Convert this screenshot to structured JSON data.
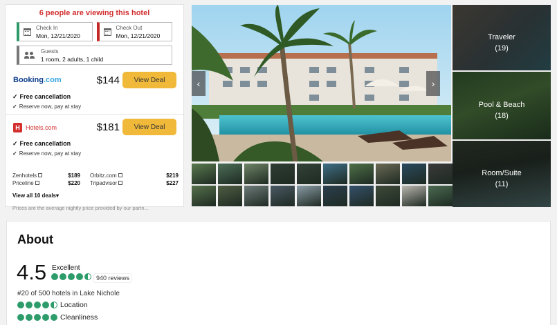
{
  "deal": {
    "viewing_notice": "6 people are viewing this hotel",
    "check_in": {
      "label": "Check In",
      "value": "Mon, 12/21/2020"
    },
    "check_out": {
      "label": "Check Out",
      "value": "Mon, 12/21/2020"
    },
    "guests": {
      "label": "Guests",
      "value": "1 room, 2 adults, 1 child"
    },
    "providers": [
      {
        "name": "Booking.com",
        "logo_main": "Booking",
        "logo_dot": ".com",
        "price": "$144",
        "button": "View Deal",
        "free_cancel": "Free cancellation",
        "reserve": "Reserve now, pay at stay"
      },
      {
        "name": "Hotels.com",
        "price": "$181",
        "button": "View Deal",
        "free_cancel": "Free cancellation",
        "reserve": "Reserve now, pay at stay"
      }
    ],
    "other_deals": [
      {
        "name": "Zenhotels",
        "price": "$189"
      },
      {
        "name": "Orbitz.com",
        "price": "$219"
      },
      {
        "name": "Priceline",
        "price": "$220"
      },
      {
        "name": "Tripadvisor",
        "price": "$227"
      }
    ],
    "view_all": "View all 10 deals",
    "footnote": "Prices are the average nightly price provided by our partn..."
  },
  "gallery": {
    "prev_icon": "chevron-left-icon",
    "next_icon": "chevron-right-icon",
    "thumb_colors": [
      "#5a7a4f",
      "#4c6e57",
      "#6f8466",
      "#2f3d34",
      "#34423a",
      "#3f6e86",
      "#4e7048",
      "#6b6a55",
      "#2a4a5e",
      "#3a3a3a",
      "#55704a",
      "#4f5d43",
      "#6c7a78",
      "#4a5864",
      "#8a9ba6",
      "#2d3f4f",
      "#34506a",
      "#3f4a3a",
      "#b9b6ae",
      "#4a6a50"
    ],
    "categories": [
      {
        "label": "Traveler",
        "count": "(19)"
      },
      {
        "label": "Pool & Beach",
        "count": "(18)"
      },
      {
        "label": "Room/Suite",
        "count": "(11)"
      }
    ]
  },
  "about": {
    "title": "About",
    "rating": "4.5",
    "rating_word": "Excellent",
    "review_count": "940 reviews",
    "rank": "#20 of 500 hotels in Lake Nichole",
    "subratings": [
      {
        "label": "Location",
        "score": 4.5
      },
      {
        "label": "Cleanliness",
        "score": 5
      }
    ]
  },
  "colors": {
    "accent_green": "#2e9c6a",
    "alert_red": "#d32f2f",
    "deal_button": "#f0b93a"
  }
}
